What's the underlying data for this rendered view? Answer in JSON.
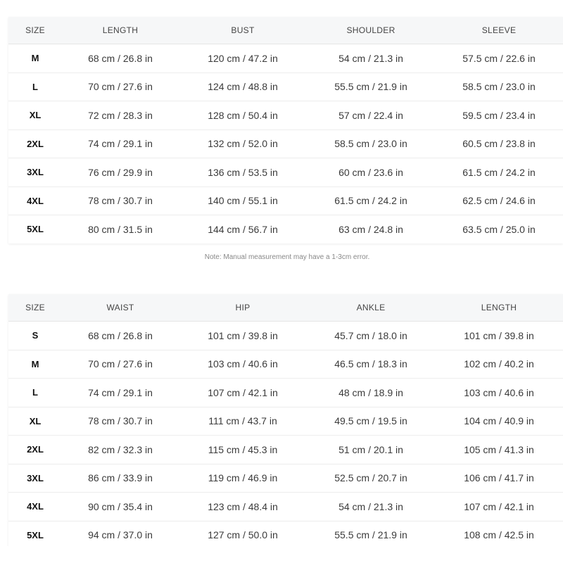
{
  "top_table": {
    "headers": [
      "SIZE",
      "LENGTH",
      "BUST",
      "SHOULDER",
      "SLEEVE"
    ],
    "rows": [
      [
        "M",
        "68 cm / 26.8 in",
        "120 cm / 47.2 in",
        "54 cm / 21.3 in",
        "57.5 cm / 22.6 in"
      ],
      [
        "L",
        "70 cm / 27.6 in",
        "124 cm / 48.8 in",
        "55.5 cm / 21.9 in",
        "58.5 cm / 23.0 in"
      ],
      [
        "XL",
        "72 cm / 28.3 in",
        "128 cm / 50.4 in",
        "57 cm / 22.4 in",
        "59.5 cm / 23.4 in"
      ],
      [
        "2XL",
        "74 cm / 29.1 in",
        "132 cm / 52.0 in",
        "58.5 cm / 23.0 in",
        "60.5 cm / 23.8 in"
      ],
      [
        "3XL",
        "76 cm / 29.9 in",
        "136 cm / 53.5 in",
        "60 cm / 23.6 in",
        "61.5 cm / 24.2 in"
      ],
      [
        "4XL",
        "78 cm / 30.7 in",
        "140 cm / 55.1 in",
        "61.5 cm / 24.2 in",
        "62.5 cm / 24.6 in"
      ],
      [
        "5XL",
        "80 cm / 31.5 in",
        "144 cm / 56.7 in",
        "63 cm / 24.8 in",
        "63.5 cm / 25.0 in"
      ]
    ]
  },
  "note": "Note: Manual measurement may have a 1-3cm error.",
  "bottom_table": {
    "headers": [
      "SIZE",
      "WAIST",
      "HIP",
      "ANKLE",
      "LENGTH"
    ],
    "rows": [
      [
        "S",
        "68 cm / 26.8 in",
        "101 cm / 39.8 in",
        "45.7 cm / 18.0 in",
        "101 cm / 39.8 in"
      ],
      [
        "M",
        "70 cm / 27.6 in",
        "103 cm / 40.6 in",
        "46.5 cm / 18.3 in",
        "102 cm / 40.2 in"
      ],
      [
        "L",
        "74 cm / 29.1 in",
        "107 cm / 42.1 in",
        "48 cm / 18.9 in",
        "103 cm / 40.6 in"
      ],
      [
        "XL",
        "78 cm / 30.7 in",
        "111 cm / 43.7 in",
        "49.5 cm / 19.5 in",
        "104 cm / 40.9 in"
      ],
      [
        "2XL",
        "82 cm / 32.3 in",
        "115 cm / 45.3 in",
        "51 cm / 20.1 in",
        "105 cm / 41.3 in"
      ],
      [
        "3XL",
        "86 cm / 33.9 in",
        "119 cm / 46.9 in",
        "52.5 cm / 20.7 in",
        "106 cm / 41.7 in"
      ],
      [
        "4XL",
        "90 cm / 35.4 in",
        "123 cm / 48.4 in",
        "54 cm / 21.3 in",
        "107 cm / 42.1 in"
      ],
      [
        "5XL",
        "94 cm / 37.0 in",
        "127 cm / 50.0 in",
        "55.5 cm / 21.9 in",
        "108 cm / 42.5 in"
      ]
    ]
  }
}
